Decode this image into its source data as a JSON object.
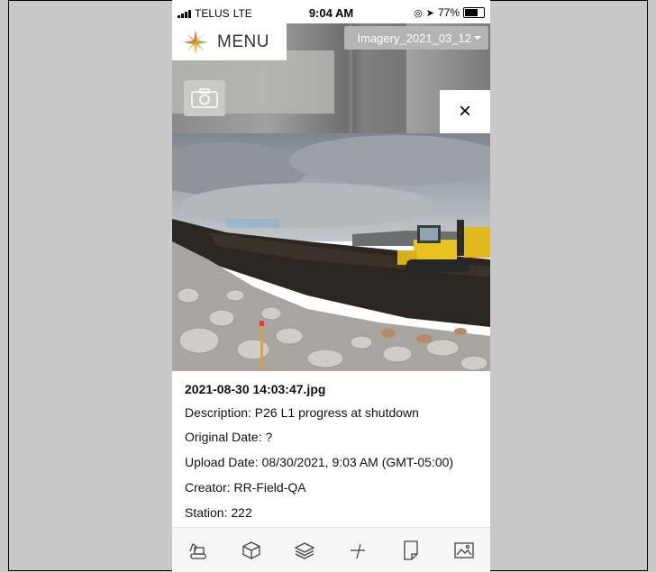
{
  "status_bar": {
    "carrier": "TELUS",
    "network": "LTE",
    "time": "9:04 AM",
    "battery": "77%",
    "battery_level": 0.77
  },
  "map": {
    "menu_label": "MENU",
    "imagery_selector": "Imagery_2021_03_12",
    "close_symbol": "×",
    "camera_icon": "camera-icon"
  },
  "photo_info": {
    "filename": "2021-08-30 14:03:47.jpg",
    "description": "Description: P26 L1 progress at shutdown",
    "original_date": "Original Date: ?",
    "upload_date": "Upload Date: 08/30/2021, 9:03 AM (GMT-05:00)",
    "creator": "Creator: RR-Field-QA",
    "station": "Station: 222"
  },
  "toolbar": {
    "icons": [
      "excavator-icon",
      "cube-icon",
      "layers-icon",
      "measure-icon",
      "note-icon",
      "image-icon"
    ]
  },
  "colors": {
    "accent_orange": "#e8742a",
    "accent_green": "#8cbf3f",
    "accent_yellow": "#f2c230"
  }
}
